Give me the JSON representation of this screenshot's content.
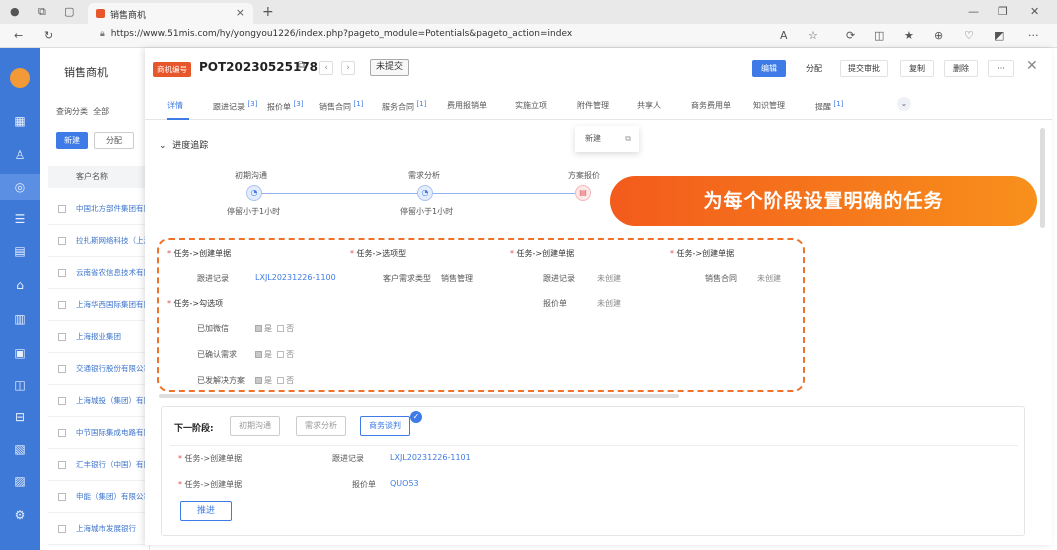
{
  "browser": {
    "tab_title": "销售商机",
    "url": "https://www.51mis.com/hy/yongyou1226/index.php?pageto_module=Potentials&pageto_action=index",
    "new_tab": "+",
    "close_tab": "×"
  },
  "list_panel": {
    "title": "销售商机",
    "filter_label": "查询分类",
    "filter_value": "全部",
    "new_button": "新建",
    "assign_button": "分配",
    "column_header": "客户名称",
    "rows": [
      "中国北方部件集团有限公司",
      "拉扎斯网络科技（上海）",
      "云南省农信息技术有限",
      "上海华西国际集团有限",
      "上海报业集团",
      "交通银行股份有限公司",
      "上海城投（集团）有限",
      "中节国际集成电路有限",
      "汇丰银行（中国）有限",
      "申能（集团）有限公司",
      "上海城市发展银行"
    ]
  },
  "detail": {
    "tag": "商机编号",
    "code": "POT20230525178",
    "status": "未提交",
    "buttons": {
      "edit": "编辑",
      "assign": "分配",
      "submit_approval": "提交审批",
      "copy": "复制",
      "delete": "删除",
      "more": "···"
    },
    "tabs": [
      {
        "label": "详情",
        "count": ""
      },
      {
        "label": "跟进记录",
        "count": "[3]"
      },
      {
        "label": "报价单",
        "count": "[3]"
      },
      {
        "label": "销售合同",
        "count": "[1]"
      },
      {
        "label": "服务合同",
        "count": "[1]"
      },
      {
        "label": "费用报销单",
        "count": ""
      },
      {
        "label": "实施立项",
        "count": ""
      },
      {
        "label": "附件管理",
        "count": ""
      },
      {
        "label": "共享人",
        "count": ""
      },
      {
        "label": "商务费用单",
        "count": ""
      },
      {
        "label": "知识管理",
        "count": ""
      },
      {
        "label": "提醒",
        "count": "[1]"
      }
    ],
    "tab_popup": "新建",
    "section_title": "进度追踪",
    "stages": [
      {
        "name": "初期沟通",
        "sub": "停留小于1小时"
      },
      {
        "name": "需求分析",
        "sub": "停留小于1小时"
      },
      {
        "name": "方案报价",
        "sub": ""
      }
    ],
    "callout": "为每个阶段设置明确的任务",
    "tasks": {
      "col1_head": "任务->创建单据",
      "col1_key": "跟进记录",
      "col1_val": "LXJL20231226-1100",
      "col1_head2": "任务->勾选项",
      "checks": [
        {
          "label": "已加微信",
          "yes": "是",
          "no": "否"
        },
        {
          "label": "已确认需求",
          "yes": "是",
          "no": "否"
        },
        {
          "label": "已发解决方案",
          "yes": "是",
          "no": "否"
        }
      ],
      "col2_head": "任务->选项型",
      "col2_key": "客户需求类型",
      "col2_val": "销售管理",
      "col3_head": "任务->创建单据",
      "col3_key1": "跟进记录",
      "col3_val1": "未创建",
      "col3_key2": "报价单",
      "col3_val2": "未创建",
      "col4_head": "任务->创建单据",
      "col4_key": "销售合同",
      "col4_val": "未创建"
    },
    "next": {
      "label": "下一阶段:",
      "options": [
        "初期沟通",
        "需求分析",
        "商务谈判"
      ],
      "row1_head": "任务->创建单据",
      "row1_key": "跟进记录",
      "row1_val": "LXJL20231226-1101",
      "row2_head": "任务->创建单据",
      "row2_key": "报价单",
      "row2_val": "QUO53",
      "advance": "推进"
    }
  },
  "colors": {
    "primary": "#3e7be6",
    "rail": "#3e79d8",
    "callout_start": "#f35b1c",
    "callout_end": "#f8901b",
    "dash": "#f0712a"
  }
}
